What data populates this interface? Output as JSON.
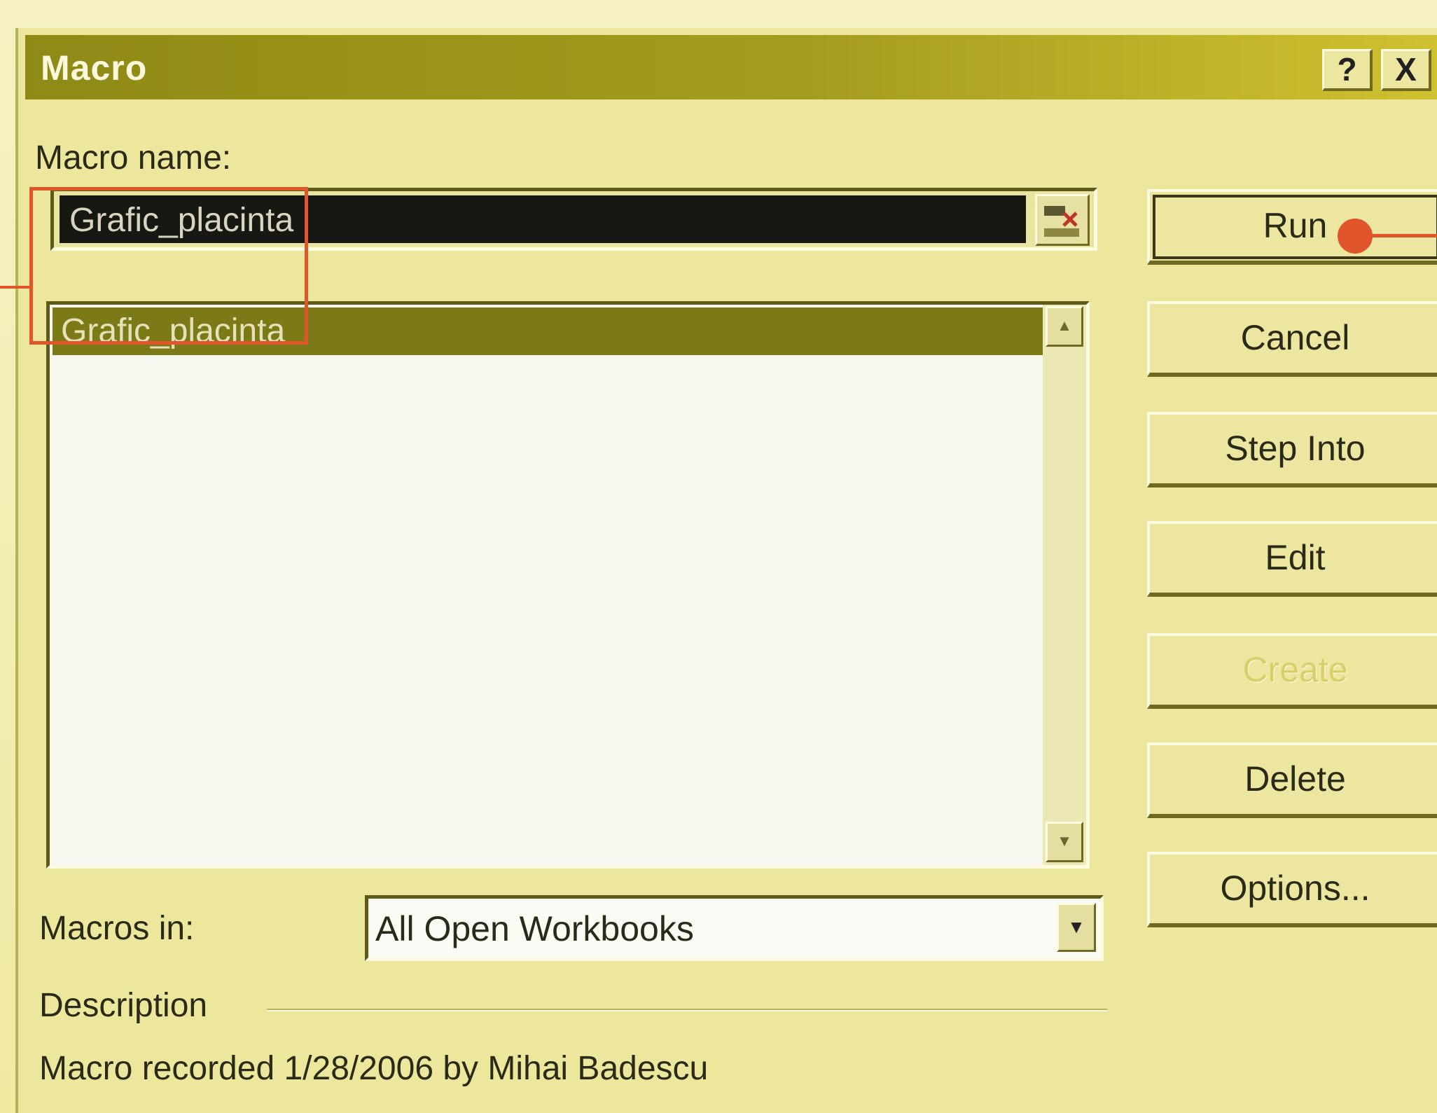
{
  "dialog": {
    "title": "Macro",
    "help_label": "?",
    "close_label": "X"
  },
  "macro_name": {
    "label": "Macro name:",
    "value": "Grafic_placinta"
  },
  "macro_list": {
    "items": [
      "Grafic_placinta"
    ]
  },
  "buttons": {
    "run": "Run",
    "cancel": "Cancel",
    "step_into": "Step Into",
    "edit": "Edit",
    "create": "Create",
    "delete": "Delete",
    "options": "Options..."
  },
  "macros_in": {
    "label": "Macros in:",
    "value": "All Open Workbooks"
  },
  "description": {
    "label": "Description",
    "text": "Macro recorded 1/28/2006 by Mihai Badescu"
  },
  "colors": {
    "dialog_bg": "#ede79e",
    "titlebar": "#8f8a16",
    "selection": "#7c7a16",
    "annotation": "#e0552a"
  }
}
